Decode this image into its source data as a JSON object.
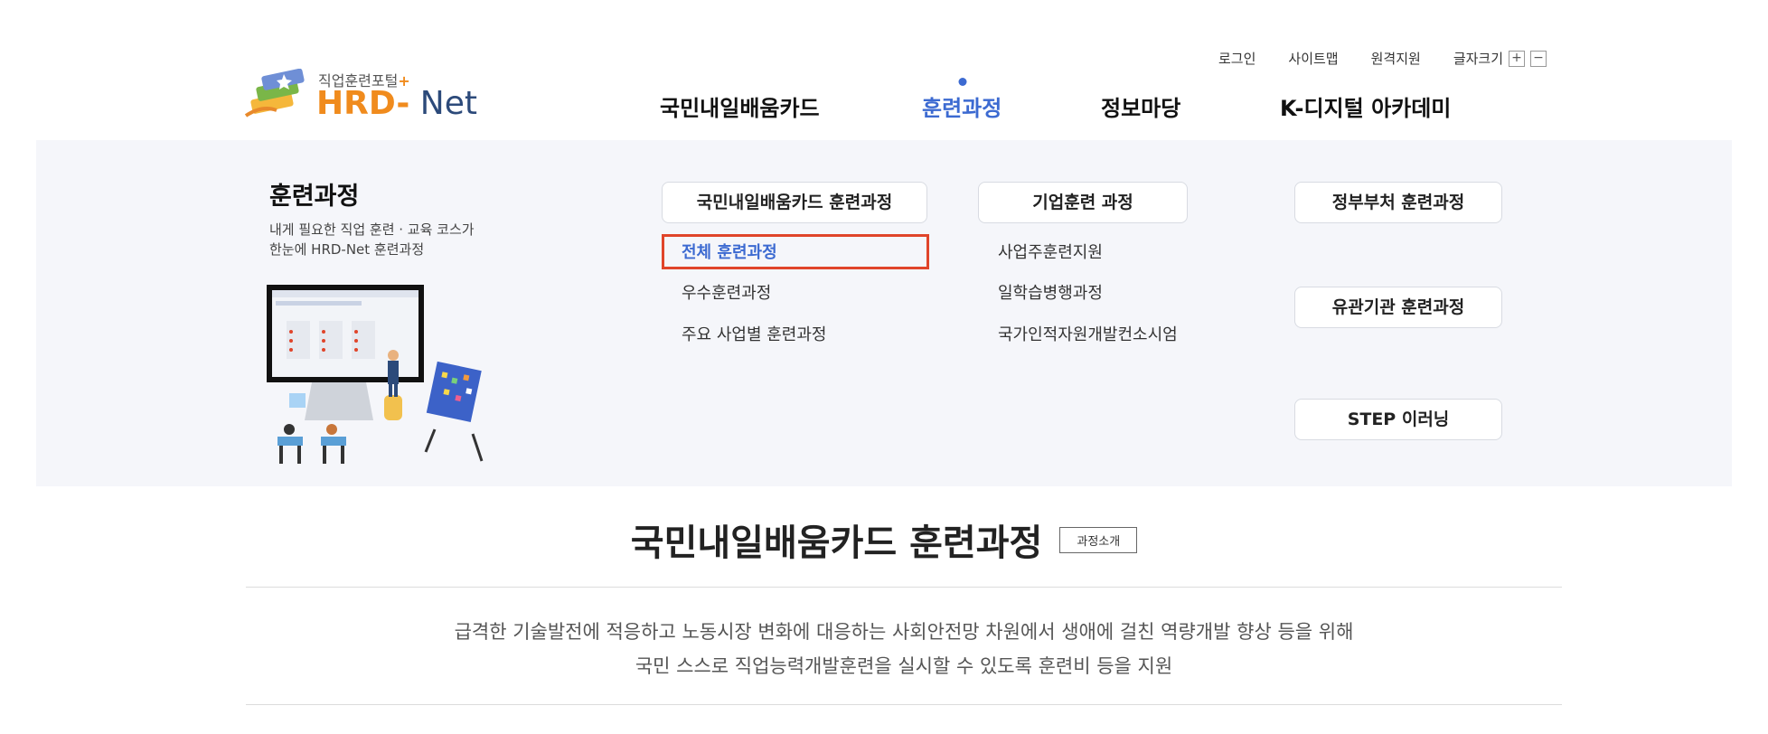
{
  "header": {
    "utility": {
      "login": "로그인",
      "sitemap": "사이트맵",
      "remote_support": "원격지원",
      "font_size": "글자크기",
      "font_increase": "+",
      "font_decrease": "−"
    },
    "logo": {
      "subtitle": "직업훈련포털",
      "plus": "+",
      "name_hrd": "HRD",
      "name_dash": "-",
      "name_net": " Net"
    },
    "gnb": [
      {
        "label": "국민내일배움카드",
        "active": false
      },
      {
        "label": "훈련과정",
        "active": true
      },
      {
        "label": "정보마당",
        "active": false
      },
      {
        "label": "K-디지털 아카데미",
        "active": false
      }
    ]
  },
  "panel": {
    "title": "훈련과정",
    "description_line1": "내게 필요한 직업 훈련 · 교육 코스가",
    "description_line2": "한눈에 HRD-Net 훈련과정",
    "columns": {
      "col1": {
        "heading": "국민내일배움카드 훈련과정",
        "links": [
          "전체 훈련과정",
          "우수훈련과정",
          "주요 사업별 훈련과정"
        ]
      },
      "col2": {
        "heading": "기업훈련 과정",
        "links": [
          "사업주훈련지원",
          "일학습병행과정",
          "국가인적자원개발컨소시엄"
        ]
      },
      "col3": {
        "headings": [
          "정부부처 훈련과정",
          "유관기관 훈련과정",
          "STEP 이러닝"
        ]
      }
    },
    "current_link": "전체 훈련과정"
  },
  "content": {
    "title": "국민내일배움카드 훈련과정",
    "badge": "과정소개",
    "description_line1": "급격한 기술발전에 적응하고 노동시장 변화에 대응하는 사회안전망 차원에서 생애에 걸친 역량개발 향상 등을 위해",
    "description_line2": "국민 스스로 직업능력개발훈련을 실시할 수 있도록 훈련비 등을 지원"
  },
  "colors": {
    "accent": "#3c6ad1",
    "brand_orange": "#f08b1d",
    "highlight": "#e0452a",
    "panel_bg": "#f5f6fa"
  }
}
